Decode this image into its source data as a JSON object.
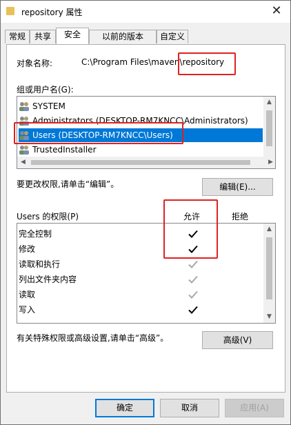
{
  "window": {
    "title": "repository 属性",
    "close_symbol": "✕"
  },
  "tabs": [
    {
      "label": "常规"
    },
    {
      "label": "共享"
    },
    {
      "label": "安全",
      "active": true
    },
    {
      "label": "以前的版本"
    },
    {
      "label": "自定义"
    }
  ],
  "object": {
    "label": "对象名称:",
    "path_prefix": "C:\\Program Files\\maven",
    "path_suffix": "\\repository"
  },
  "groups": {
    "label": "组或用户名(G):",
    "items": [
      {
        "name": "SYSTEM",
        "selected": false
      },
      {
        "name": "Administrators (DESKTOP-RM7KNCC\\Administrators)",
        "selected": false
      },
      {
        "name": "Users (DESKTOP-RM7KNCC\\Users)",
        "selected": true
      },
      {
        "name": "TrustedInstaller",
        "selected": false
      }
    ]
  },
  "edit": {
    "hint": "要更改权限,请单击“编辑”。",
    "button_label": "编辑(E)..."
  },
  "permissions": {
    "title": "Users 的权限(P)",
    "allow_header": "允许",
    "deny_header": "拒绝",
    "rows": [
      {
        "name": "完全控制",
        "allow": "dark"
      },
      {
        "name": "修改",
        "allow": "dark"
      },
      {
        "name": "读取和执行",
        "allow": "gray"
      },
      {
        "name": "列出文件夹内容",
        "allow": "gray"
      },
      {
        "name": "读取",
        "allow": "gray"
      },
      {
        "name": "写入",
        "allow": "dark"
      }
    ]
  },
  "advanced": {
    "hint": "有关特殊权限或高级设置,请单击“高级”。",
    "button_label": "高级(V)"
  },
  "footer": {
    "ok_label": "确定",
    "cancel_label": "取消",
    "apply_label": "应用(A)"
  },
  "colors": {
    "highlight": "#e02020",
    "selection": "#0078d7"
  }
}
